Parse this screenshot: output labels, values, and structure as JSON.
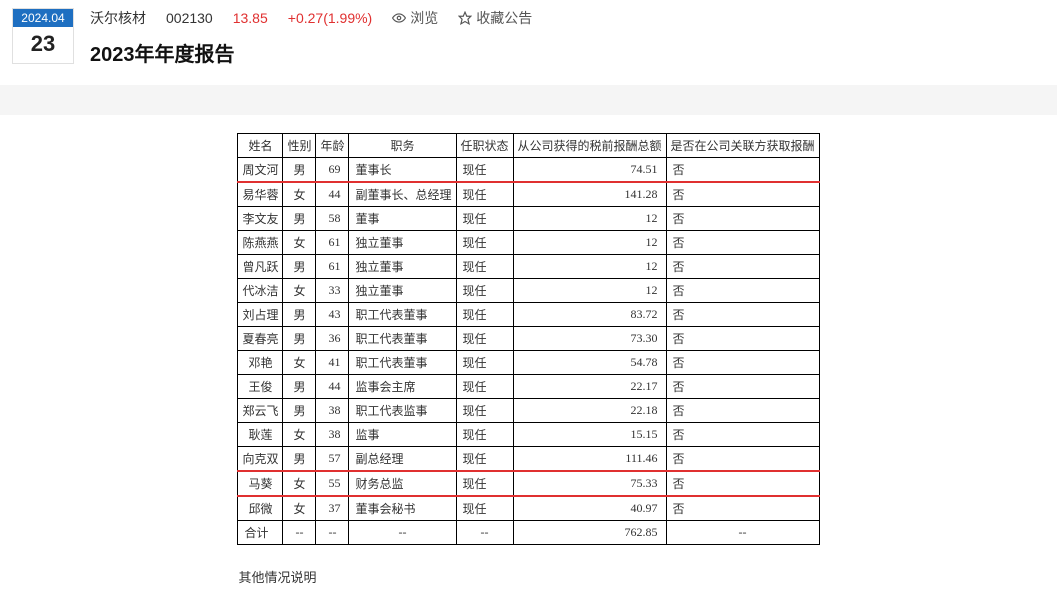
{
  "header": {
    "date_ym": "2024.04",
    "date_d": "23",
    "stock_name": "沃尔核材",
    "stock_code": "002130",
    "price": "13.85",
    "change": "+0.27(1.99%)",
    "view": "浏览",
    "favorite": "收藏公告",
    "report_title": "2023年年度报告"
  },
  "table": {
    "headers": [
      "姓名",
      "性别",
      "年龄",
      "职务",
      "任职状态",
      "从公司获得的税前报酬总额",
      "是否在公司关联方获取报酬"
    ],
    "rows": [
      {
        "name": "周文河",
        "gender": "男",
        "age": "69",
        "title": "董事长",
        "status": "现任",
        "pay": "74.51",
        "rel": "否",
        "hl": true
      },
      {
        "name": "易华蓉",
        "gender": "女",
        "age": "44",
        "title": "副董事长、总经理",
        "status": "现任",
        "pay": "141.28",
        "rel": "否",
        "hl": false
      },
      {
        "name": "李文友",
        "gender": "男",
        "age": "58",
        "title": "董事",
        "status": "现任",
        "pay": "12",
        "rel": "否",
        "hl": false
      },
      {
        "name": "陈燕燕",
        "gender": "女",
        "age": "61",
        "title": "独立董事",
        "status": "现任",
        "pay": "12",
        "rel": "否",
        "hl": false
      },
      {
        "name": "曾凡跃",
        "gender": "男",
        "age": "61",
        "title": "独立董事",
        "status": "现任",
        "pay": "12",
        "rel": "否",
        "hl": false
      },
      {
        "name": "代冰洁",
        "gender": "女",
        "age": "33",
        "title": "独立董事",
        "status": "现任",
        "pay": "12",
        "rel": "否",
        "hl": false
      },
      {
        "name": "刘占理",
        "gender": "男",
        "age": "43",
        "title": "职工代表董事",
        "status": "现任",
        "pay": "83.72",
        "rel": "否",
        "hl": false
      },
      {
        "name": "夏春亮",
        "gender": "男",
        "age": "36",
        "title": "职工代表董事",
        "status": "现任",
        "pay": "73.30",
        "rel": "否",
        "hl": false
      },
      {
        "name": "邓艳",
        "gender": "女",
        "age": "41",
        "title": "职工代表董事",
        "status": "现任",
        "pay": "54.78",
        "rel": "否",
        "hl": false
      },
      {
        "name": "王俊",
        "gender": "男",
        "age": "44",
        "title": "监事会主席",
        "status": "现任",
        "pay": "22.17",
        "rel": "否",
        "hl": false
      },
      {
        "name": "郑云飞",
        "gender": "男",
        "age": "38",
        "title": "职工代表监事",
        "status": "现任",
        "pay": "22.18",
        "rel": "否",
        "hl": false
      },
      {
        "name": "耿莲",
        "gender": "女",
        "age": "38",
        "title": "监事",
        "status": "现任",
        "pay": "15.15",
        "rel": "否",
        "hl": false
      },
      {
        "name": "向克双",
        "gender": "男",
        "age": "57",
        "title": "副总经理",
        "status": "现任",
        "pay": "111.46",
        "rel": "否",
        "hl": true
      },
      {
        "name": "马葵",
        "gender": "女",
        "age": "55",
        "title": "财务总监",
        "status": "现任",
        "pay": "75.33",
        "rel": "否",
        "hl": true
      },
      {
        "name": "邱微",
        "gender": "女",
        "age": "37",
        "title": "董事会秘书",
        "status": "现任",
        "pay": "40.97",
        "rel": "否",
        "hl": false
      }
    ],
    "total_label": "合计",
    "dash": "--",
    "total_pay": "762.85"
  },
  "other_note": "其他情况说明"
}
